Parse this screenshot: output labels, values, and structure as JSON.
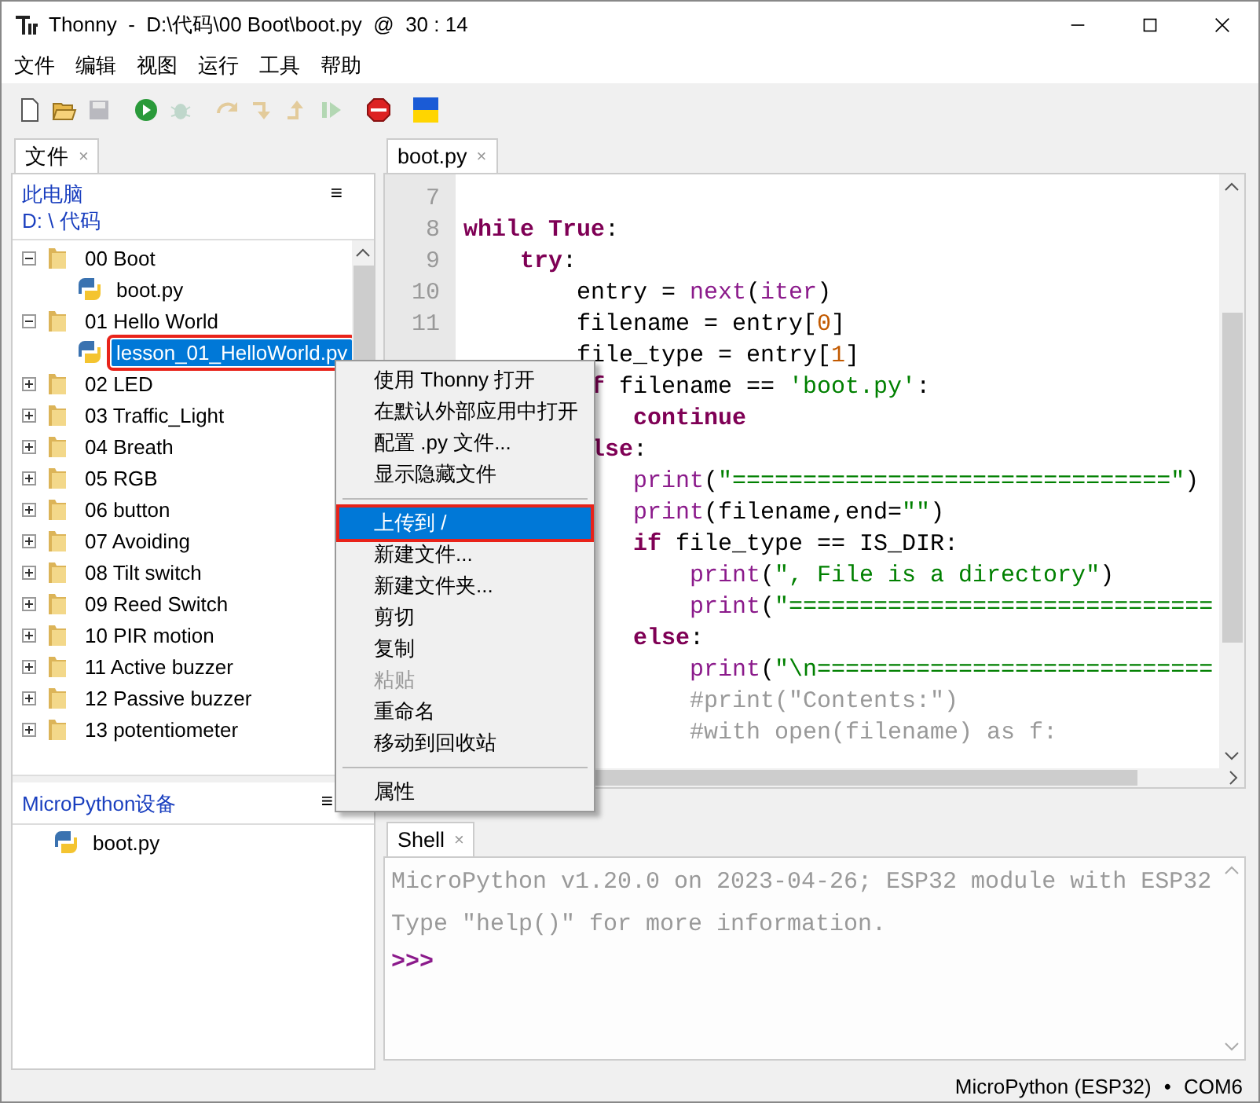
{
  "window": {
    "title": "Thonny  -  D:\\代码\\00 Boot\\boot.py  @  30 : 14"
  },
  "menu": [
    "文件",
    "编辑",
    "视图",
    "运行",
    "工具",
    "帮助"
  ],
  "toolbar": [
    {
      "kind": "new",
      "disabled": false
    },
    {
      "kind": "open",
      "disabled": false
    },
    {
      "kind": "save",
      "disabled": true
    },
    {
      "kind": "run",
      "disabled": false
    },
    {
      "kind": "debug",
      "disabled": true
    },
    {
      "kind": "step_over",
      "disabled": true
    },
    {
      "kind": "step_into",
      "disabled": true
    },
    {
      "kind": "step_out",
      "disabled": true
    },
    {
      "kind": "resume",
      "disabled": true
    },
    {
      "kind": "stop",
      "disabled": false
    },
    {
      "kind": "flag",
      "disabled": false
    }
  ],
  "files_tab": {
    "label": "文件",
    "close": "×"
  },
  "files": {
    "location": "此电脑",
    "path": "D: \\ 代码",
    "menu": "≡",
    "tree": [
      {
        "kind": "folder",
        "name": "00 Boot",
        "expanded": true,
        "selected": false,
        "children": [
          {
            "kind": "file",
            "name": "boot.py",
            "selected": false
          }
        ]
      },
      {
        "kind": "folder",
        "name": "01 Hello World",
        "expanded": true,
        "selected": false,
        "children": [
          {
            "kind": "file",
            "name": "lesson_01_HelloWorld.py",
            "selected": true
          }
        ]
      },
      {
        "kind": "folder",
        "name": "02 LED",
        "expanded": false,
        "selected": false
      },
      {
        "kind": "folder",
        "name": "03 Traffic_Light",
        "expanded": false,
        "selected": false
      },
      {
        "kind": "folder",
        "name": "04 Breath",
        "expanded": false,
        "selected": false
      },
      {
        "kind": "folder",
        "name": "05 RGB",
        "expanded": false,
        "selected": false
      },
      {
        "kind": "folder",
        "name": "06 button",
        "expanded": false,
        "selected": false
      },
      {
        "kind": "folder",
        "name": "07 Avoiding",
        "expanded": false,
        "selected": false
      },
      {
        "kind": "folder",
        "name": "08 Tilt switch",
        "expanded": false,
        "selected": false
      },
      {
        "kind": "folder",
        "name": "09 Reed Switch",
        "expanded": false,
        "selected": false
      },
      {
        "kind": "folder",
        "name": "10 PIR motion",
        "expanded": false,
        "selected": false
      },
      {
        "kind": "folder",
        "name": "11 Active buzzer",
        "expanded": false,
        "selected": false
      },
      {
        "kind": "folder",
        "name": "12 Passive buzzer",
        "expanded": false,
        "selected": false
      },
      {
        "kind": "folder",
        "name": "13 potentiometer",
        "expanded": false,
        "selected": false
      }
    ]
  },
  "device": {
    "title": "MicroPython设备",
    "menu": "≡",
    "files": [
      {
        "kind": "file",
        "name": "boot.py",
        "selected": false
      }
    ]
  },
  "editor_tab": {
    "label": "boot.py",
    "close": "×"
  },
  "line_numbers": [
    "7",
    "8",
    "9",
    "10",
    "11"
  ],
  "code": [
    {
      "blank": true
    },
    {
      "blank": false,
      "tokens": [
        {
          "kind": "kw",
          "text": "while True"
        },
        {
          "kind": "plain",
          "text": ":"
        }
      ]
    },
    {
      "blank": false,
      "tokens": [
        {
          "kind": "kw",
          "text": "    try"
        },
        {
          "kind": "plain",
          "text": ":"
        }
      ]
    },
    {
      "blank": false,
      "tokens": [
        {
          "kind": "plain",
          "text": "        entry = "
        },
        {
          "kind": "builtin",
          "text": "next"
        },
        {
          "kind": "plain",
          "text": "("
        },
        {
          "kind": "builtin",
          "text": "iter"
        },
        {
          "kind": "plain",
          "text": ")"
        }
      ]
    },
    {
      "blank": false,
      "tokens": [
        {
          "kind": "plain",
          "text": "        filename = entry["
        },
        {
          "kind": "num",
          "text": "0"
        },
        {
          "kind": "plain",
          "text": "]"
        }
      ]
    },
    {
      "blank": false,
      "tokens": [
        {
          "kind": "plain",
          "text": "        file_type = entry["
        },
        {
          "kind": "num",
          "text": "1"
        },
        {
          "kind": "plain",
          "text": "]"
        }
      ]
    },
    {
      "blank": false,
      "tokens": [
        {
          "kind": "kw",
          "text": "         f"
        },
        {
          "kind": "plain",
          "text": " filename == "
        },
        {
          "kind": "str",
          "text": "'boot.py'"
        },
        {
          "kind": "plain",
          "text": ":"
        }
      ]
    },
    {
      "blank": false,
      "tokens": [
        {
          "kind": "kw",
          "text": "            continue"
        }
      ]
    },
    {
      "blank": false,
      "tokens": [
        {
          "kind": "kw",
          "text": "         lse"
        },
        {
          "kind": "plain",
          "text": ":"
        }
      ]
    },
    {
      "blank": false,
      "tokens": [
        {
          "kind": "builtin",
          "text": "            print"
        },
        {
          "kind": "plain",
          "text": "("
        },
        {
          "kind": "str",
          "text": "\"===============================\""
        },
        {
          "kind": "plain",
          "text": ")"
        }
      ]
    },
    {
      "blank": false,
      "tokens": [
        {
          "kind": "builtin",
          "text": "            print"
        },
        {
          "kind": "plain",
          "text": "(filename,end="
        },
        {
          "kind": "str",
          "text": "\"\""
        },
        {
          "kind": "plain",
          "text": ")"
        }
      ]
    },
    {
      "blank": false,
      "tokens": [
        {
          "kind": "kw",
          "text": "            if"
        },
        {
          "kind": "plain",
          "text": " file_type == IS_DIR:"
        }
      ]
    },
    {
      "blank": false,
      "tokens": [
        {
          "kind": "builtin",
          "text": "                print"
        },
        {
          "kind": "plain",
          "text": "("
        },
        {
          "kind": "str",
          "text": "\", File is a directory\""
        },
        {
          "kind": "plain",
          "text": ")"
        }
      ]
    },
    {
      "blank": false,
      "tokens": [
        {
          "kind": "builtin",
          "text": "                print"
        },
        {
          "kind": "plain",
          "text": "("
        },
        {
          "kind": "str",
          "text": "\"=============================="
        }
      ]
    },
    {
      "blank": false,
      "tokens": [
        {
          "kind": "kw",
          "text": "            else"
        },
        {
          "kind": "plain",
          "text": ":"
        }
      ]
    },
    {
      "blank": false,
      "tokens": [
        {
          "kind": "builtin",
          "text": "                print"
        },
        {
          "kind": "plain",
          "text": "("
        },
        {
          "kind": "str",
          "text": "\"\\n============================"
        }
      ]
    },
    {
      "blank": false,
      "tokens": [
        {
          "kind": "comment",
          "text": "                #print(\"Contents:\")"
        }
      ]
    },
    {
      "blank": false,
      "tokens": [
        {
          "kind": "comment",
          "text": "                #with open(filename) as f:"
        }
      ]
    }
  ],
  "shell_tab": {
    "label": "Shell",
    "close": "×"
  },
  "shell": [
    {
      "kind": "output",
      "text": "MicroPython v1.20.0 on 2023-04-26; ESP32 module with ESP32"
    },
    {
      "kind": "output",
      "text": "Type \"help()\" for more information."
    },
    {
      "kind": "prompt",
      "text": ">>>"
    }
  ],
  "context_menu": [
    {
      "kind": "item",
      "label": "使用 Thonny 打开",
      "selected": false,
      "disabled": false
    },
    {
      "kind": "item",
      "label": "在默认外部应用中打开",
      "selected": false,
      "disabled": false
    },
    {
      "kind": "item",
      "label": "配置 .py 文件...",
      "selected": false,
      "disabled": false
    },
    {
      "kind": "item",
      "label": "显示隐藏文件",
      "selected": false,
      "disabled": false
    },
    {
      "kind": "separator"
    },
    {
      "kind": "item",
      "label": "上传到 /",
      "selected": true,
      "disabled": false
    },
    {
      "kind": "item",
      "label": "新建文件...",
      "selected": false,
      "disabled": false
    },
    {
      "kind": "item",
      "label": "新建文件夹...",
      "selected": false,
      "disabled": false
    },
    {
      "kind": "item",
      "label": "剪切",
      "selected": false,
      "disabled": false
    },
    {
      "kind": "item",
      "label": "复制",
      "selected": false,
      "disabled": false
    },
    {
      "kind": "item",
      "label": "粘贴",
      "selected": false,
      "disabled": true
    },
    {
      "kind": "item",
      "label": "重命名",
      "selected": false,
      "disabled": false
    },
    {
      "kind": "item",
      "label": "移动到回收站",
      "selected": false,
      "disabled": false
    },
    {
      "kind": "separator"
    },
    {
      "kind": "item",
      "label": "属性",
      "selected": false,
      "disabled": false
    }
  ],
  "status_bar": [
    "MicroPython (ESP32)",
    "•",
    "COM6"
  ]
}
